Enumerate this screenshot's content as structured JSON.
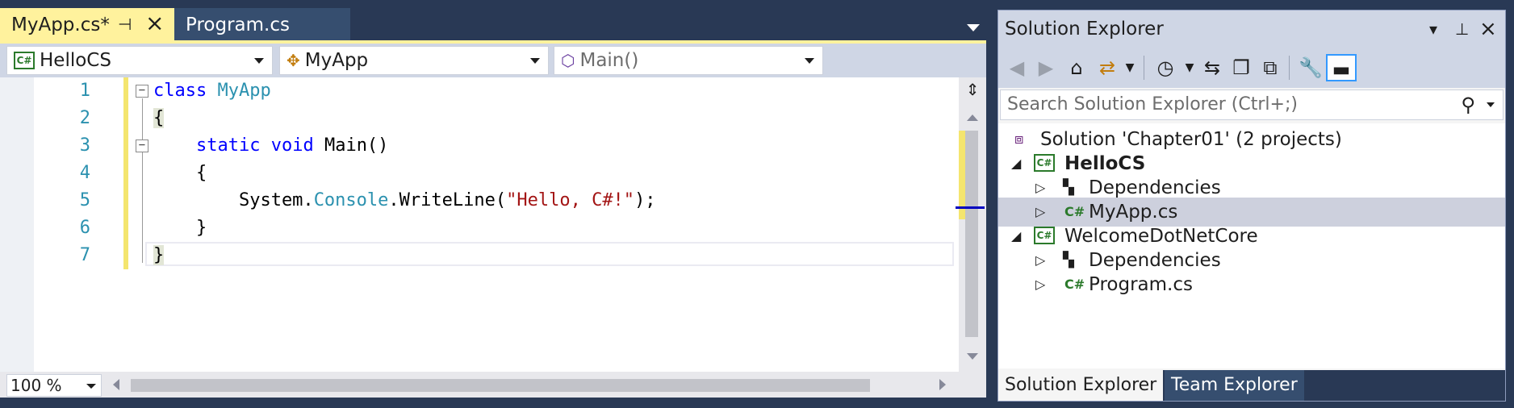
{
  "editor": {
    "tabs": [
      {
        "label": "MyApp.cs*",
        "active": true
      },
      {
        "label": "Program.cs",
        "active": false
      }
    ],
    "pin_glyph": "⊣",
    "close_glyph": "×",
    "nav": {
      "project": "HelloCS",
      "class": "MyApp",
      "member": "Main()"
    },
    "line_numbers": [
      "1",
      "2",
      "3",
      "4",
      "5",
      "6",
      "7"
    ],
    "code": {
      "l1_kw": "class",
      "l1_type": "MyApp",
      "l2": "{",
      "l3_indent": "    ",
      "l3_kw1": "static",
      "l3_kw2": "void",
      "l3_rest": "Main()",
      "l4": "    {",
      "l5_pre": "        System.",
      "l5_type": "Console",
      "l5_mid": ".WriteLine(",
      "l5_str": "\"Hello, C#!\"",
      "l5_end": ");",
      "l6": "    }",
      "l7": "}"
    },
    "zoom": "100 %"
  },
  "solution_explorer": {
    "title": "Solution Explorer",
    "search_placeholder": "Search Solution Explorer (Ctrl+;)",
    "tree": [
      {
        "label": "Solution 'Chapter01' (2 projects)"
      },
      {
        "label": "HelloCS"
      },
      {
        "label": "Dependencies"
      },
      {
        "label": "MyApp.cs",
        "selected": true
      },
      {
        "label": "WelcomeDotNetCore"
      },
      {
        "label": "Dependencies"
      },
      {
        "label": "Program.cs"
      }
    ],
    "bottom_tabs": [
      "Solution Explorer",
      "Team Explorer"
    ]
  },
  "colors": {
    "active_tab": "#fff29d",
    "background": "#293955",
    "keyword": "#0000ff",
    "type": "#2b91af",
    "string": "#a31515"
  },
  "icons": [
    "pin-icon",
    "close-icon",
    "csharp-icon",
    "home-icon",
    "search-icon",
    "wrench-icon"
  ]
}
